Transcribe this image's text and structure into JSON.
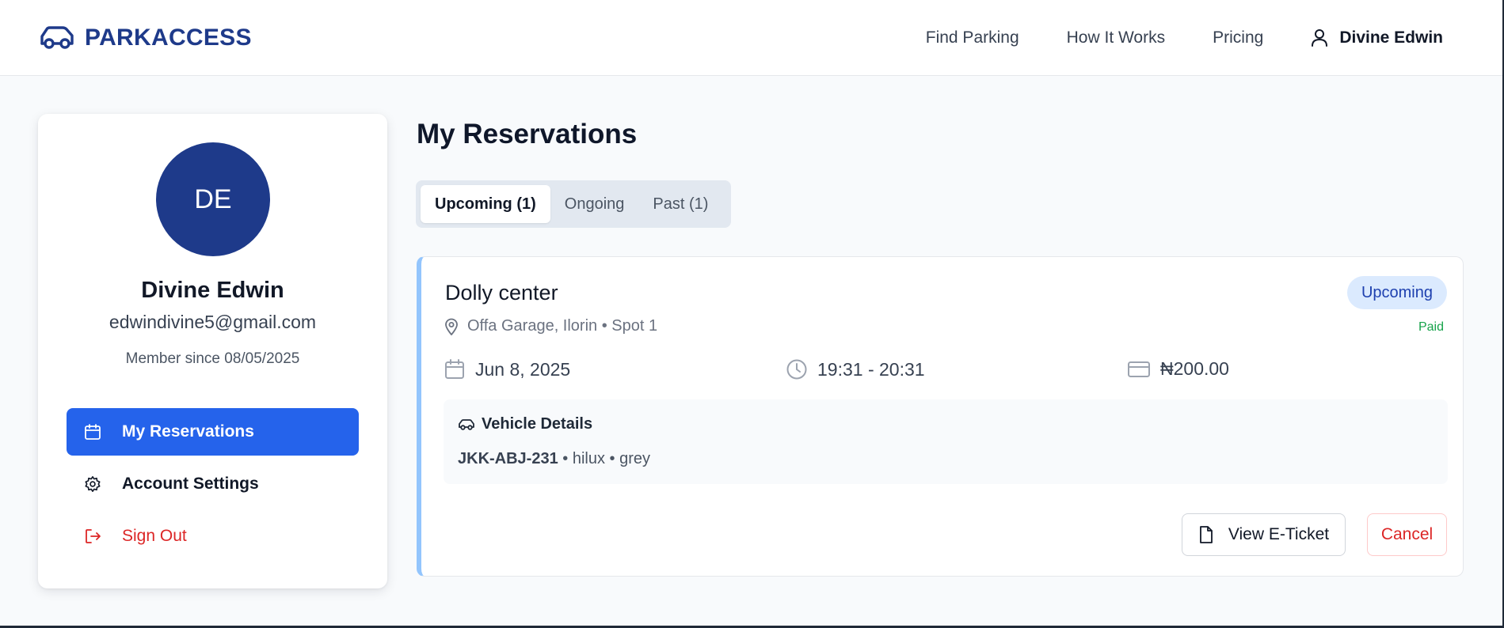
{
  "header": {
    "brand": "PARKACCESS",
    "nav": [
      "Find Parking",
      "How It Works",
      "Pricing"
    ],
    "user": "Divine Edwin"
  },
  "profile": {
    "initials": "DE",
    "name": "Divine Edwin",
    "email": "edwindivine5@gmail.com",
    "member_since": "Member since 08/05/2025",
    "menu": [
      {
        "label": "My Reservations",
        "icon": "calendar-icon",
        "active": true
      },
      {
        "label": "Account Settings",
        "icon": "gear-icon",
        "active": false
      },
      {
        "label": "Sign Out",
        "icon": "sign-out-icon",
        "active": false
      }
    ]
  },
  "main": {
    "title": "My Reservations",
    "tabs": [
      {
        "label": "Upcoming (1)",
        "active": true
      },
      {
        "label": "Ongoing",
        "active": false
      },
      {
        "label": "Past (1)",
        "active": false
      }
    ]
  },
  "reservation": {
    "name": "Dolly center",
    "location": "Offa Garage, Ilorin • Spot 1",
    "status": "Upcoming",
    "payment": "Paid",
    "date": "Jun 8, 2025",
    "time": "19:31 - 20:31",
    "price": "₦200.00",
    "vehicle_heading": "Vehicle Details",
    "vehicle_plate": "JKK-ABJ-231",
    "vehicle_rest": " • hilux • grey",
    "actions": {
      "ticket": "View E-Ticket",
      "cancel": "Cancel"
    }
  },
  "colors": {
    "brand": "#1e3a8a",
    "accent": "#2563eb",
    "danger": "#dc2626",
    "success": "#16a34a",
    "card_border_accent": "#93c5fd"
  }
}
